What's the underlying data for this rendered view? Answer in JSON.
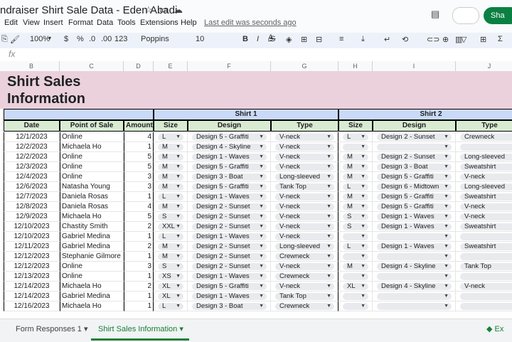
{
  "doc_title": "ndraiser Shirt Sale Data - Eden Abadi",
  "menus": [
    "Edit",
    "View",
    "Insert",
    "Format",
    "Data",
    "Tools",
    "Extensions",
    "Help"
  ],
  "last_edit": "Last edit was seconds ago",
  "share_label": "Sha",
  "toolbar": {
    "zoom": "100%",
    "currency": "$",
    "percent": "%",
    "dec_less": ".0",
    "dec_more": ".00",
    "format": "123",
    "font": "Poppins",
    "size": "10",
    "bold": "B",
    "italic": "I",
    "strike": "S",
    "color": "A"
  },
  "fx": "fx",
  "columns": [
    "B",
    "C",
    "D",
    "E",
    "F",
    "G",
    "H",
    "I",
    "J"
  ],
  "title": "Shirt Sales Information",
  "group_headers": {
    "shirt1": "Shirt 1",
    "shirt2": "Shirt 2"
  },
  "headers": [
    "Date",
    "Point of Sale",
    "Amount",
    "Size",
    "Design",
    "Type",
    "Size",
    "Design",
    "Type"
  ],
  "rows": [
    [
      "12/1/2023",
      "Online",
      "4",
      "L",
      "Design 5 - Graffiti",
      "V-neck",
      "L",
      "Design 2 - Sunset",
      "Crewneck"
    ],
    [
      "12/2/2023",
      "Michaela Ho",
      "1",
      "M",
      "Design 4 - Skyline",
      "V-neck",
      "",
      "",
      ""
    ],
    [
      "12/2/2023",
      "Online",
      "5",
      "M",
      "Design 1 - Waves",
      "V-neck",
      "M",
      "Design 2 - Sunset",
      "Long-sleeved"
    ],
    [
      "12/3/2023",
      "Online",
      "5",
      "M",
      "Design 5 - Graffiti",
      "V-neck",
      "M",
      "Design 3 - Boat",
      "Sweatshirt"
    ],
    [
      "12/4/2023",
      "Online",
      "3",
      "M",
      "Design 3 - Boat",
      "Long-sleeved",
      "M",
      "Design 5 - Graffiti",
      "V-neck"
    ],
    [
      "12/6/2023",
      "Natasha Young",
      "3",
      "M",
      "Design 5 - Graffiti",
      "Tank Top",
      "L",
      "Design 6 - Midtown",
      "Long-sleeved"
    ],
    [
      "12/7/2023",
      "Daniela Rosas",
      "1",
      "L",
      "Design 1 - Waves",
      "V-neck",
      "M",
      "Design 5 - Graffiti",
      "Sweatshirt"
    ],
    [
      "12/8/2023",
      "Daniela Rosas",
      "4",
      "M",
      "Design 2 - Sunset",
      "V-neck",
      "M",
      "Design 5 - Graffiti",
      "V-neck"
    ],
    [
      "12/9/2023",
      "Michaela Ho",
      "5",
      "S",
      "Design 2 - Sunset",
      "V-neck",
      "S",
      "Design 1 - Waves",
      "V-neck"
    ],
    [
      "12/10/2023",
      "Chastity Smith",
      "2",
      "XXL",
      "Design 2 - Sunset",
      "V-neck",
      "S",
      "Design 1 - Waves",
      "Sweatshirt"
    ],
    [
      "12/10/2023",
      "Gabriel Medina",
      "1",
      "L",
      "Design 1 - Waves",
      "V-neck",
      "",
      "",
      ""
    ],
    [
      "12/11/2023",
      "Gabriel Medina",
      "2",
      "M",
      "Design 2 - Sunset",
      "Long-sleeved",
      "L",
      "Design 1 - Waves",
      "Sweatshirt"
    ],
    [
      "12/12/2023",
      "Stephanie Gilmore",
      "1",
      "M",
      "Design 2 - Sunset",
      "Crewneck",
      "",
      "",
      ""
    ],
    [
      "12/12/2023",
      "Online",
      "3",
      "S",
      "Design 2 - Sunset",
      "V-neck",
      "M",
      "Design 4 - Skyline",
      "Tank Top"
    ],
    [
      "12/13/2023",
      "Online",
      "1",
      "XS",
      "Design 1 - Waves",
      "Crewneck",
      "",
      "",
      ""
    ],
    [
      "12/14/2023",
      "Michaela Ho",
      "2",
      "XL",
      "Design 5 - Graffiti",
      "V-neck",
      "XL",
      "Design 4 - Skyline",
      "V-neck"
    ],
    [
      "12/14/2023",
      "Gabriel Medina",
      "1",
      "XL",
      "Design 1 - Waves",
      "Tank Top",
      "",
      "",
      ""
    ],
    [
      "12/16/2023",
      "Michaela Ho",
      "1",
      "L",
      "Design 3 - Boat",
      "Crewneck",
      "",
      "",
      ""
    ]
  ],
  "sheet_tabs": [
    "Form Responses 1",
    "Shirt Sales Information"
  ],
  "explore_label": "Ex"
}
